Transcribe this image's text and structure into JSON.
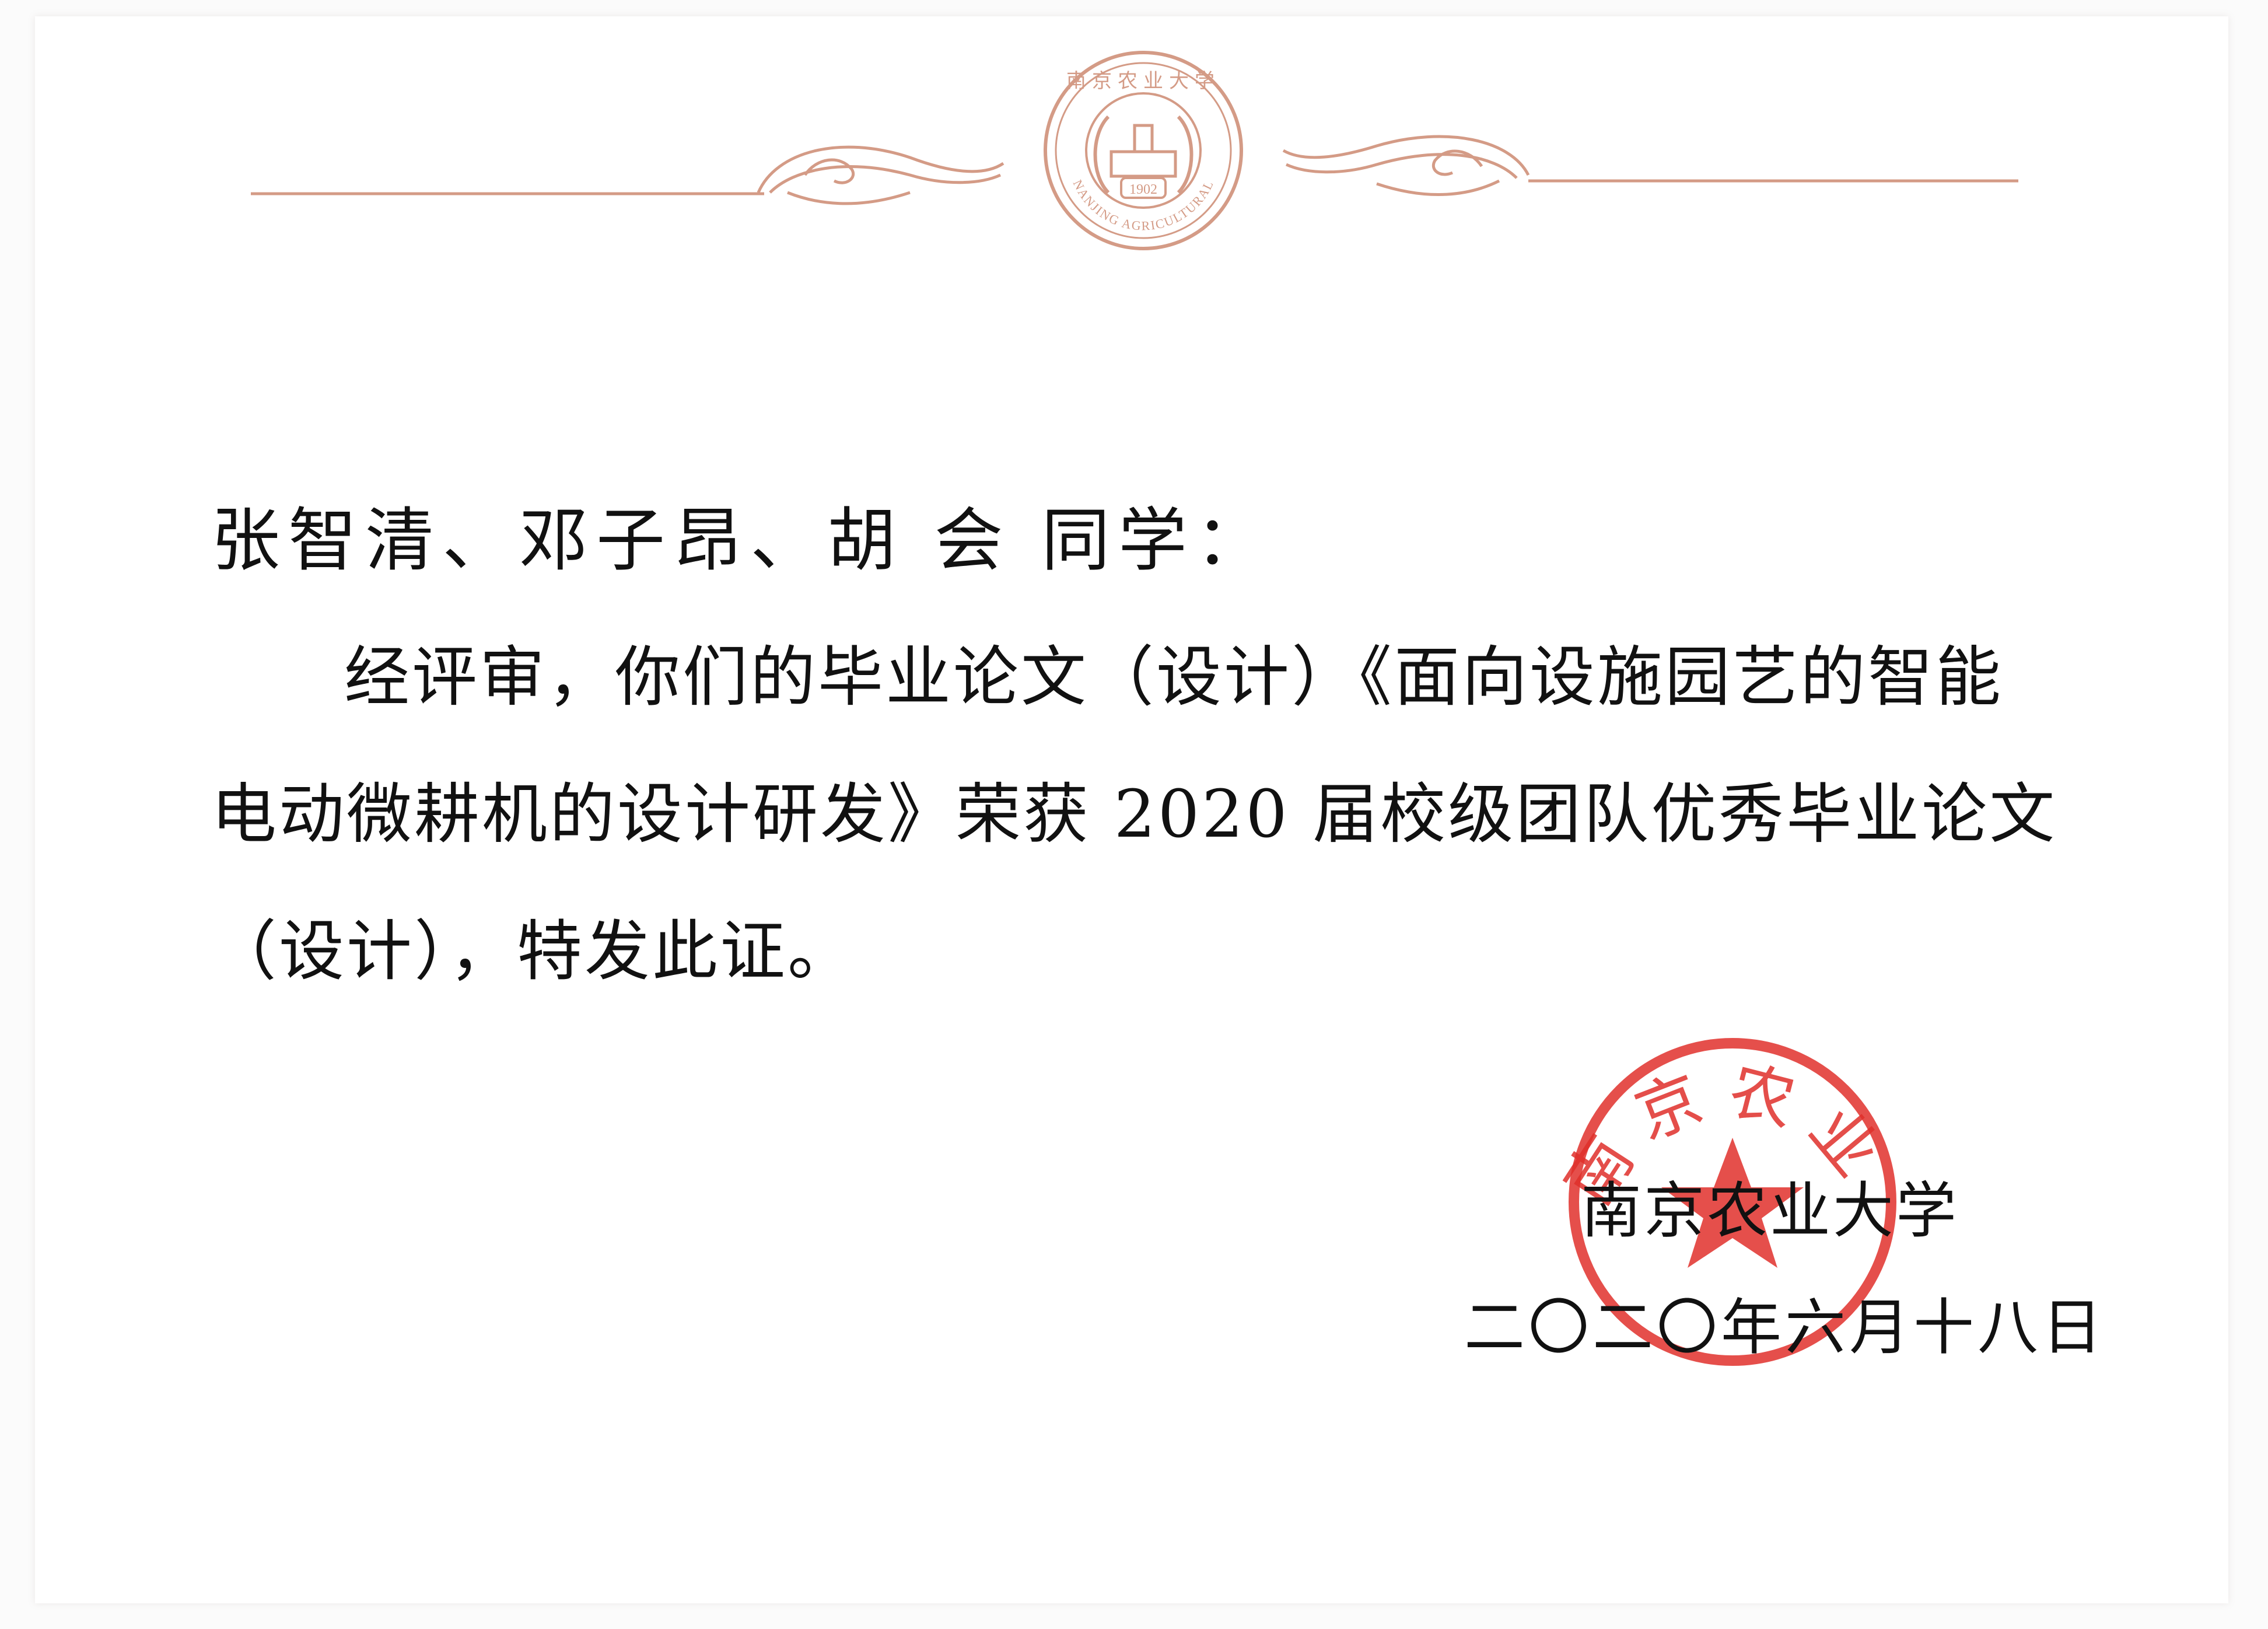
{
  "emblem": {
    "year": "1902",
    "name_en": "NANJING AGRICULTURAL UNIVERSITY",
    "name_cn": "南京农业大学"
  },
  "certificate": {
    "salutation": "张智清、邓子昂、胡 会 同学：",
    "line1": "经评审，你们的毕业论文（设计）《面向设施园艺的智能",
    "line2": "电动微耕机的设计研发》荣获 2020 届校级团队优秀毕业论文",
    "line3": "（设计），特发此证。",
    "issuer": "南京农业大学",
    "date": "二〇二〇年六月十八日"
  },
  "stamp": {
    "text": "南京农业大学"
  },
  "colors": {
    "ornament": "#d49b86",
    "stamp": "#e0302b",
    "text": "#111111"
  }
}
